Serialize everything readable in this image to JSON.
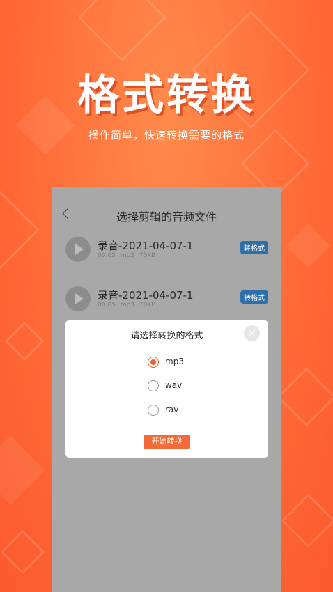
{
  "hero": {
    "title": "格式转换",
    "subtitle": "操作简单，快速转换需要的格式"
  },
  "screen": {
    "title": "选择剪辑的音频文件",
    "back_icon": "chevron-left-icon",
    "recordings": [
      {
        "name": "录音-2021-04-07-1",
        "duration": "00:05",
        "format": "mp3",
        "size": "70KB",
        "action": "转格式"
      },
      {
        "name": "录音-2021-04-07-1",
        "duration": "00:05",
        "format": "mp3",
        "size": "70KB",
        "action": "转格式"
      }
    ]
  },
  "dialog": {
    "title": "请选择转换的格式",
    "close_icon": "close-icon",
    "options": [
      {
        "label": "mp3",
        "selected": true
      },
      {
        "label": "wav",
        "selected": false
      },
      {
        "label": "rav",
        "selected": false
      }
    ],
    "start_label": "开始转换"
  },
  "colors": {
    "background": "#ff6f3c",
    "accent": "#f0602e",
    "badge": "#2f6fa8"
  }
}
